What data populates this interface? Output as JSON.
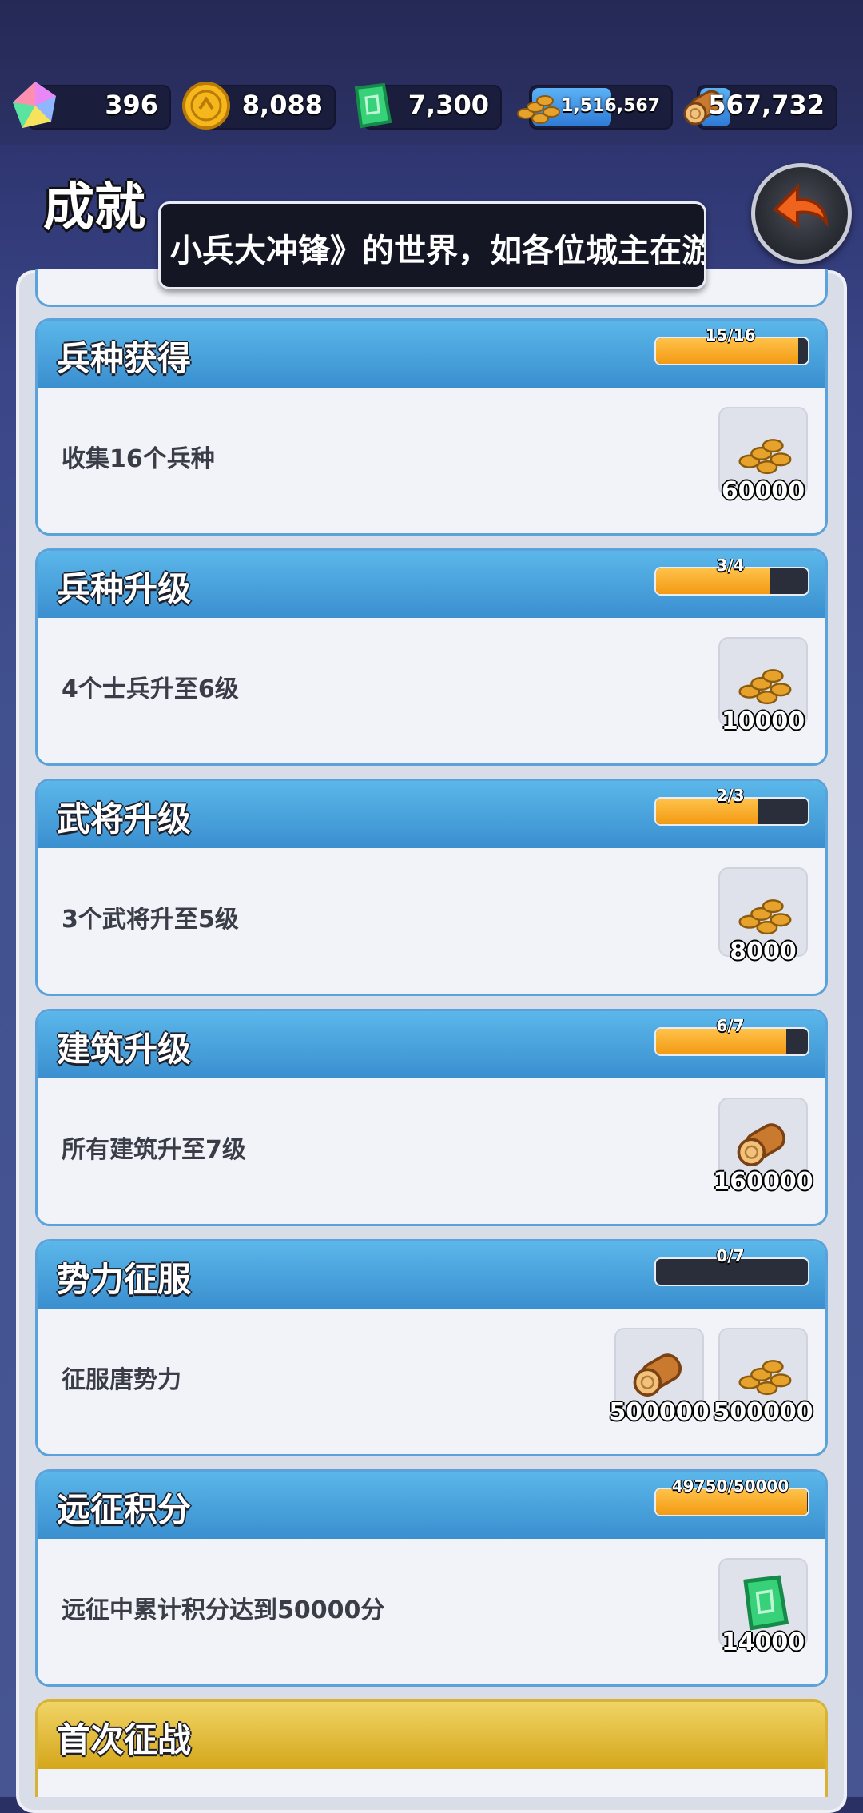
{
  "resources": [
    {
      "icon": "crystal-icon",
      "value": "396"
    },
    {
      "icon": "gold-coin-icon",
      "value": "8,088"
    },
    {
      "icon": "jade-token-icon",
      "value": "7,300"
    },
    {
      "icon": "grain-icon",
      "value": "1,516,567"
    },
    {
      "icon": "wood-log-icon",
      "value": "567,732"
    }
  ],
  "page": {
    "title": "成就"
  },
  "marquee": {
    "text": "小兵大冲锋》的世界，如各位城主在游"
  },
  "achievements": [
    {
      "name": "兵种获得",
      "progress_text": "15/16",
      "progress": 0.9375,
      "description": "收集16个兵种",
      "rewards": [
        {
          "icon": "grain-icon",
          "amount": "60000"
        }
      ]
    },
    {
      "name": "兵种升级",
      "progress_text": "3/4",
      "progress": 0.75,
      "description": "4个士兵升至6级",
      "rewards": [
        {
          "icon": "grain-icon",
          "amount": "10000"
        }
      ]
    },
    {
      "name": "武将升级",
      "progress_text": "2/3",
      "progress": 0.6667,
      "description": "3个武将升至5级",
      "rewards": [
        {
          "icon": "grain-icon",
          "amount": "8000"
        }
      ]
    },
    {
      "name": "建筑升级",
      "progress_text": "6/7",
      "progress": 0.857,
      "description": "所有建筑升至7级",
      "rewards": [
        {
          "icon": "wood-log-icon",
          "amount": "160000"
        }
      ]
    },
    {
      "name": "势力征服",
      "progress_text": "0/7",
      "progress": 0,
      "description": "征服唐势力",
      "rewards": [
        {
          "icon": "wood-log-icon",
          "amount": "500000"
        },
        {
          "icon": "grain-icon",
          "amount": "500000"
        }
      ]
    },
    {
      "name": "远征积分",
      "progress_text": "49750/50000",
      "progress": 0.995,
      "description": "远征中累计积分达到50000分",
      "rewards": [
        {
          "icon": "jade-token-icon",
          "amount": "14000"
        }
      ]
    }
  ],
  "next_card": {
    "name": "首次征战"
  },
  "colors": {
    "header_blue": "#3a8fcf",
    "progress_orange": "#f39a13",
    "gold_header": "#d4a61a"
  }
}
